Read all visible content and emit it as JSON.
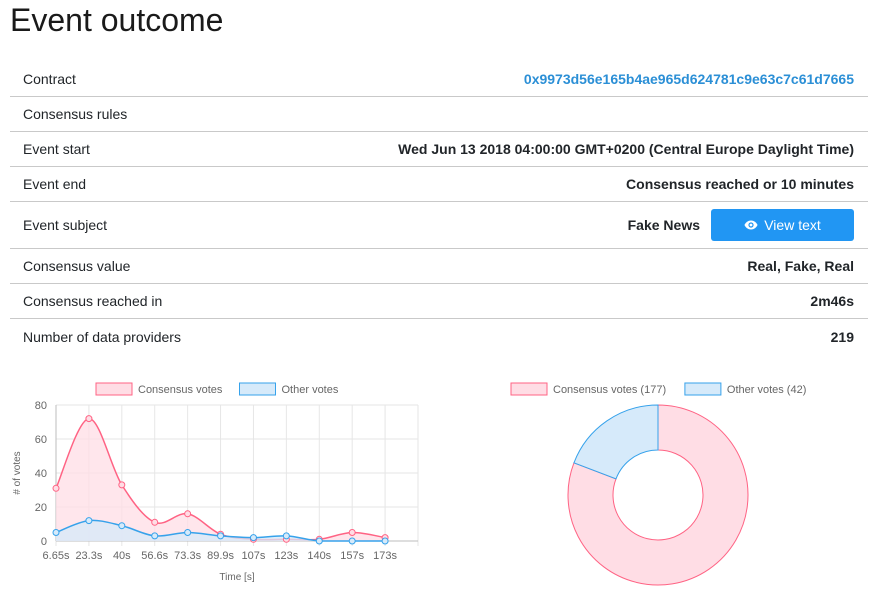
{
  "page": {
    "title": "Event outcome"
  },
  "details": {
    "contract": {
      "label": "Contract",
      "value": "0x9973d56e165b4ae965d624781c9e63c7c61d7665"
    },
    "rules": {
      "label": "Consensus rules",
      "value": ""
    },
    "start": {
      "label": "Event start",
      "value": "Wed Jun 13 2018 04:00:00 GMT+0200 (Central Europe Daylight Time)"
    },
    "end": {
      "label": "Event end",
      "value": "Consensus reached or 10 minutes"
    },
    "subject": {
      "label": "Event subject",
      "value": "Fake News",
      "button_label": "View text"
    },
    "consensus_value": {
      "label": "Consensus value",
      "value": "Real, Fake, Real"
    },
    "reached_in": {
      "label": "Consensus reached in",
      "value": "2m46s"
    },
    "providers": {
      "label": "Number of data providers",
      "value": "219"
    }
  },
  "chart_data": [
    {
      "type": "area",
      "x": [
        "6.65s",
        "23.3s",
        "40s",
        "56.6s",
        "73.3s",
        "89.9s",
        "107s",
        "123s",
        "140s",
        "157s",
        "173s"
      ],
      "series": [
        {
          "name": "Consensus votes",
          "values": [
            31,
            72,
            33,
            11,
            16,
            4,
            1,
            1,
            1,
            5,
            2
          ],
          "color": "#ff6384",
          "fill": "#ffdde5"
        },
        {
          "name": "Other votes",
          "values": [
            5,
            12,
            9,
            3,
            5,
            3,
            2,
            3,
            0,
            0,
            0
          ],
          "color": "#36a2eb",
          "fill": "#d6eafa"
        }
      ],
      "xlabel": "Time [s]",
      "ylabel": "# of votes",
      "ylim": [
        0,
        80
      ],
      "yticks": [
        0,
        20,
        40,
        60,
        80
      ],
      "grid": true,
      "legend": "top"
    },
    {
      "type": "pie",
      "categories": [
        "Consensus votes (177)",
        "Other votes (42)"
      ],
      "values": [
        177,
        42
      ],
      "colors": [
        "#ff6384",
        "#36a2eb"
      ],
      "fills": [
        "#ffdde5",
        "#d6eafa"
      ],
      "legend": "top"
    }
  ]
}
